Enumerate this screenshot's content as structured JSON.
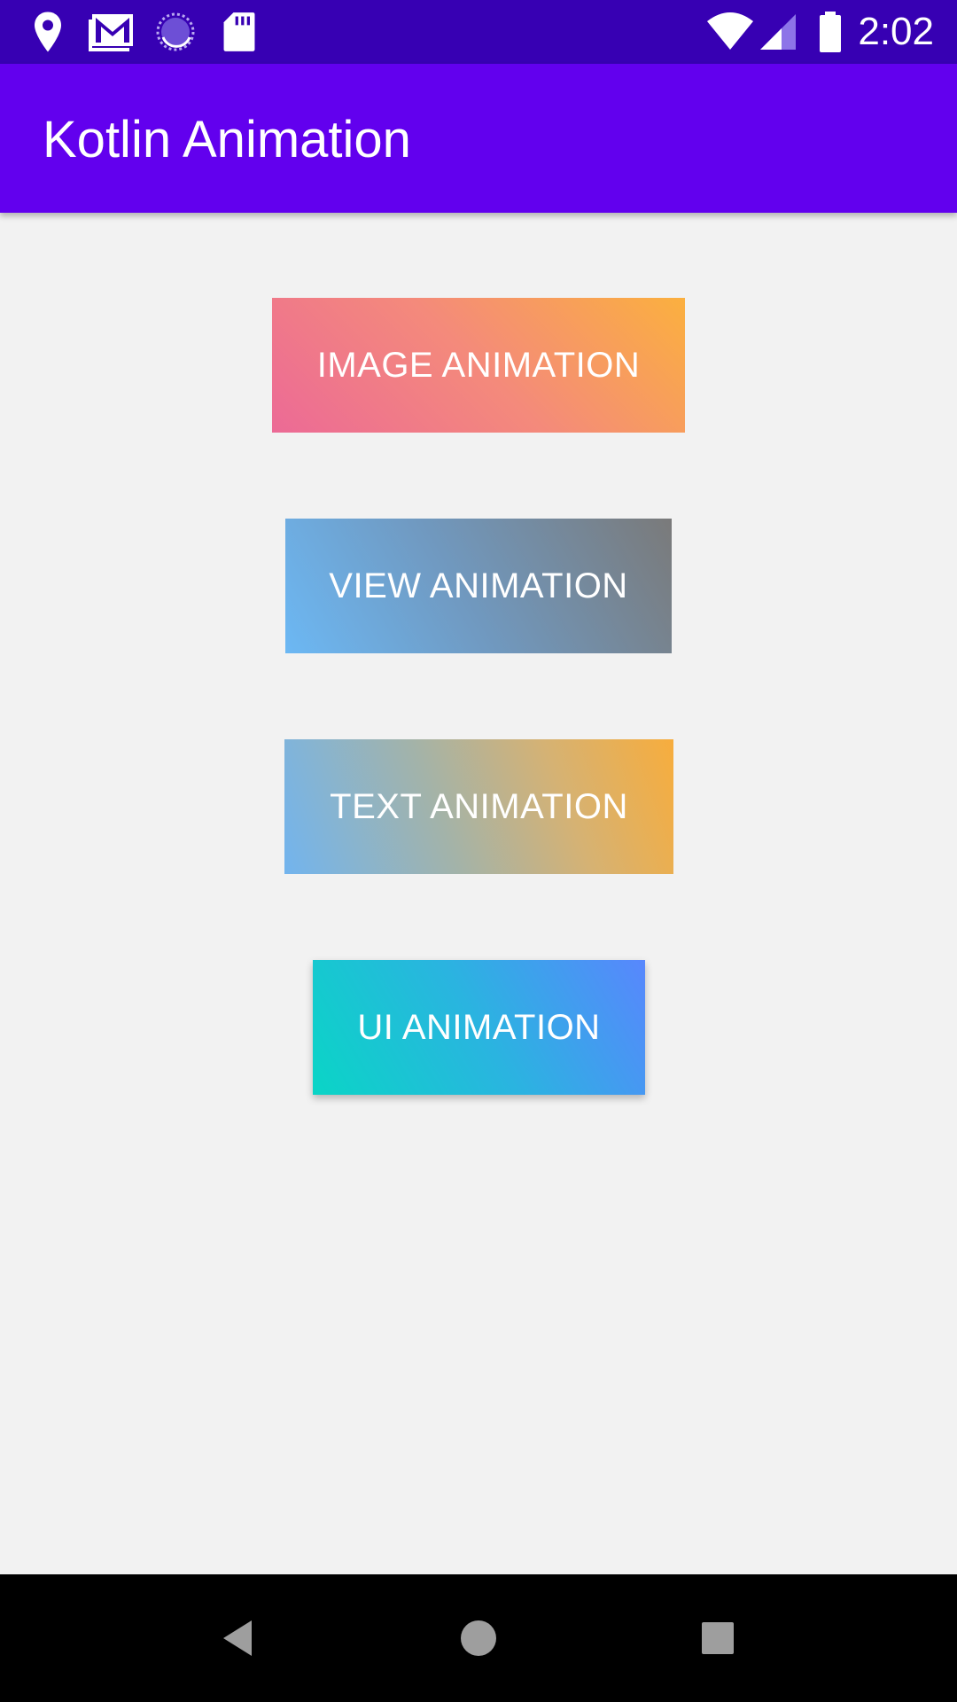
{
  "status_bar": {
    "time": "2:02",
    "icons": [
      "location-icon",
      "gmail-icon",
      "sync-spinner-icon",
      "sd-card-icon",
      "wifi-icon",
      "cell-signal-icon",
      "battery-icon"
    ]
  },
  "app_bar": {
    "title": "Kotlin Animation"
  },
  "buttons": [
    {
      "label": "IMAGE ANIMATION"
    },
    {
      "label": "VIEW ANIMATION"
    },
    {
      "label": "TEXT ANIMATION"
    },
    {
      "label": "UI ANIMATION"
    }
  ],
  "nav_bar": {
    "icons": [
      "back-icon",
      "home-icon",
      "recents-icon"
    ]
  },
  "colors": {
    "status_bar": "#3700b3",
    "app_bar": "#6200ee",
    "background": "#f2f2f2",
    "nav_bar": "#000000"
  }
}
